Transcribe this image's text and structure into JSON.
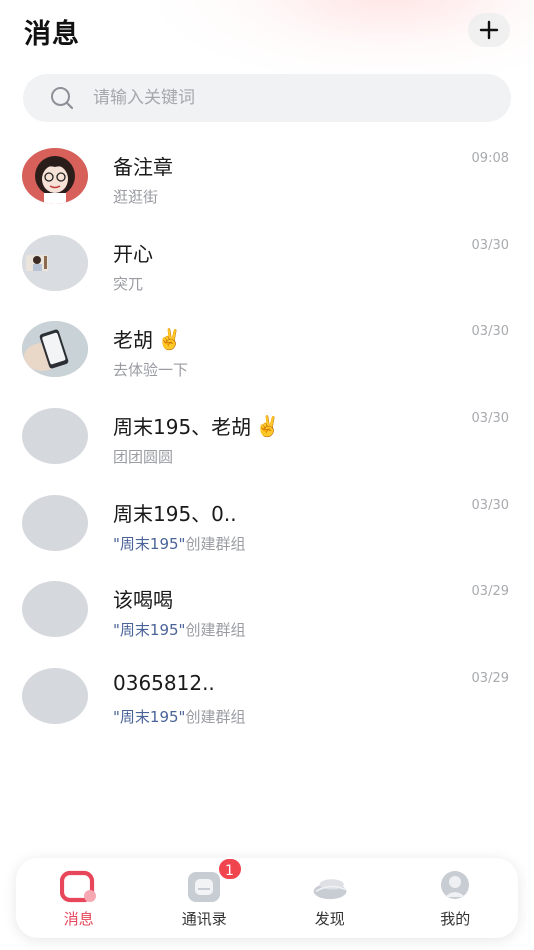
{
  "header": {
    "title": "消息",
    "add_label": "+"
  },
  "search": {
    "placeholder": "请输入关键词"
  },
  "conversations": [
    {
      "name": "备注章",
      "emoji": "",
      "sub_quote": "",
      "sub_text": "逛逛街",
      "time": "09:08",
      "avatar": "cartoon-girl"
    },
    {
      "name": "开心",
      "emoji": "",
      "sub_quote": "",
      "sub_text": "突兀",
      "time": "03/30",
      "avatar": "photo-small"
    },
    {
      "name": "老胡",
      "emoji": "✌️",
      "sub_quote": "",
      "sub_text": "去体验一下",
      "time": "03/30",
      "avatar": "hand-phone"
    },
    {
      "name": "周末195、老胡",
      "emoji": "✌️",
      "sub_quote": "",
      "sub_text": "团团圆圆",
      "time": "03/30",
      "avatar": "placeholder"
    },
    {
      "name": "周末195、0..",
      "emoji": "",
      "sub_quote": "\"周末195\"",
      "sub_text": "创建群组",
      "time": "03/30",
      "avatar": "placeholder"
    },
    {
      "name": "该喝喝",
      "emoji": "",
      "sub_quote": "\"周末195\"",
      "sub_text": "创建群组",
      "time": "03/29",
      "avatar": "placeholder"
    },
    {
      "name": "0365812..",
      "emoji": "",
      "sub_quote": "\"周末195\"",
      "sub_text": "创建群组",
      "time": "03/29",
      "avatar": "placeholder"
    }
  ],
  "tabbar": {
    "tabs": [
      {
        "label": "消息",
        "icon": "message-icon",
        "active": true
      },
      {
        "label": "通讯录",
        "icon": "contacts-icon",
        "active": false
      },
      {
        "label": "发现",
        "icon": "discover-icon",
        "active": false
      },
      {
        "label": "我的",
        "icon": "profile-icon",
        "active": false
      }
    ],
    "contacts_badge": "1"
  },
  "colors": {
    "accent": "#e8465a",
    "quote_blue": "#4a6398",
    "badge": "#f0454f"
  }
}
